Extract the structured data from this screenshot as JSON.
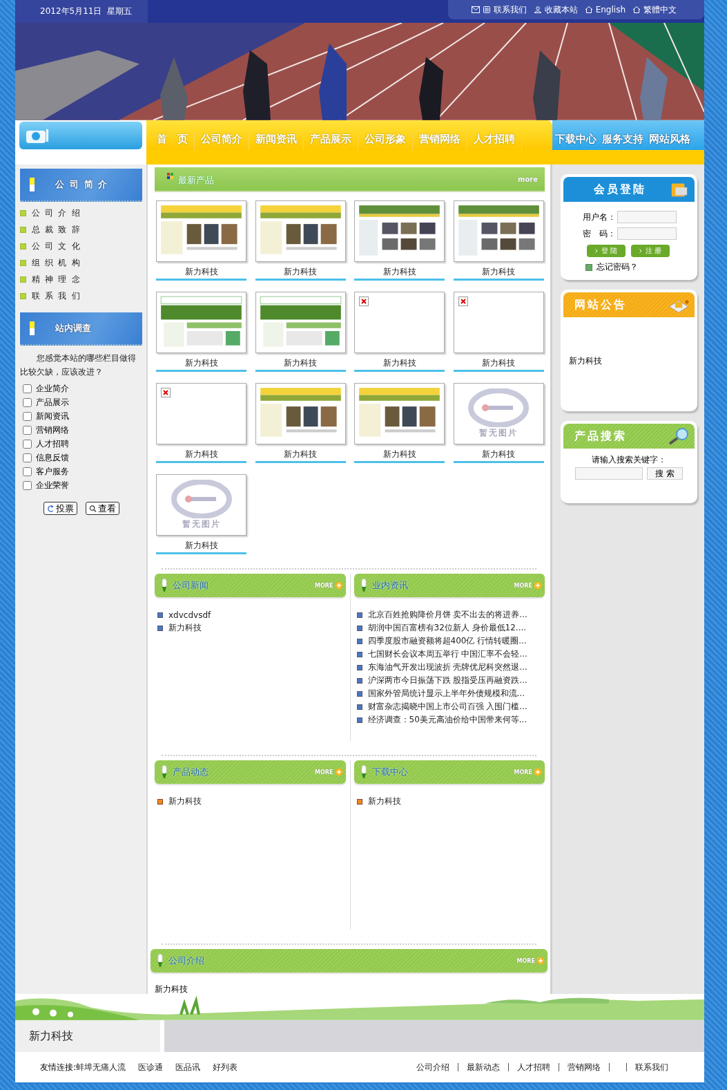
{
  "top_bar": {
    "date": "2012年5月11日  星期五",
    "links": [
      {
        "label": "联系我们",
        "kind": "contact"
      },
      {
        "label": "收藏本站",
        "kind": "bookmark"
      },
      {
        "label": "English",
        "kind": "language"
      },
      {
        "label": "繁體中文",
        "kind": "language"
      }
    ]
  },
  "nav": {
    "items": [
      {
        "label": "首　页",
        "kind": "main"
      },
      {
        "label": "公司简介",
        "kind": "main"
      },
      {
        "label": "新闻资讯",
        "kind": "main"
      },
      {
        "label": "产品展示",
        "kind": "main"
      },
      {
        "label": "公司形象",
        "kind": "main"
      },
      {
        "label": "营销网络",
        "kind": "main"
      },
      {
        "label": "人才招聘",
        "kind": "main"
      },
      {
        "label": "下载中心",
        "kind": "extra"
      },
      {
        "label": "服务支持",
        "kind": "extra"
      },
      {
        "label": "网站风格",
        "kind": "extra"
      }
    ]
  },
  "sidebar": {
    "about": {
      "title": "公司简介",
      "items": [
        "公司介绍",
        "总裁致辞",
        "公司文化",
        "组织机构",
        "精神理念",
        "联系我们"
      ]
    },
    "survey": {
      "title": "站内调查",
      "question": "您感觉本站的哪些栏目做得比较欠缺，应该改进？",
      "options": [
        {
          "label": "企业简介",
          "checked": false
        },
        {
          "label": "产品展示",
          "checked": false
        },
        {
          "label": "新闻资讯",
          "checked": false
        },
        {
          "label": "营销网络",
          "checked": false
        },
        {
          "label": "人才招聘",
          "checked": false
        },
        {
          "label": "信息反馈",
          "checked": false
        },
        {
          "label": "客户服务",
          "checked": false
        },
        {
          "label": "企业荣誉",
          "checked": false
        }
      ],
      "buttons": [
        {
          "label": "投票",
          "kind": "vote"
        },
        {
          "label": "查看",
          "kind": "view"
        }
      ]
    }
  },
  "products": {
    "title": "最新产品",
    "more": "more",
    "items": [
      {
        "caption": "新力科技",
        "kind": "yellow"
      },
      {
        "caption": "新力科技",
        "kind": "yellow"
      },
      {
        "caption": "新力科技",
        "kind": "green"
      },
      {
        "caption": "新力科技",
        "kind": "green"
      },
      {
        "caption": "新力科技",
        "kind": "welcome"
      },
      {
        "caption": "新力科技",
        "kind": "welcome"
      },
      {
        "caption": "新力科技",
        "kind": "broken"
      },
      {
        "caption": "新力科技",
        "kind": "broken"
      },
      {
        "caption": "新力科技",
        "kind": "broken"
      },
      {
        "caption": "新力科技",
        "kind": "yellow"
      },
      {
        "caption": "新力科技",
        "kind": "yellow"
      },
      {
        "caption": "新力科技",
        "kind": "empty",
        "placeholder_text": "暂无图片"
      },
      {
        "caption": "新力科技",
        "kind": "empty",
        "placeholder_text": "暂无图片"
      }
    ]
  },
  "news_rows": [
    [
      {
        "title": "公司新闻",
        "more": "MORE",
        "kind": "news",
        "items": [
          "xdvcdvsdf",
          "新力科技"
        ]
      },
      {
        "title": "业内资讯",
        "more": "MORE",
        "kind": "news",
        "items": [
          "北京百姓抢购降价月饼 卖不出去的将进养...",
          "胡润中国百富榜有32位新人 身价最低12....",
          "四季度股市融资额将超400亿 行情转暖圈...",
          "七国财长会议本周五举行 中国汇率不会轻...",
          "东海油气开发出现波折 壳牌优尼科突然退...",
          "沪深两市今日振荡下跌 股指受压再融资跌...",
          "国家外管局统计显示上半年外债规模和流...",
          "财富杂志揭晓中国上市公司百强 入围门槛...",
          "经济调查：50美元高油价给中国带来何等..."
        ]
      }
    ],
    [
      {
        "title": "产品动态",
        "more": "MORE",
        "kind": "updates",
        "items": [
          "新力科技"
        ]
      },
      {
        "title": "下载中心",
        "more": "MORE",
        "kind": "updates",
        "items": [
          "新力科技"
        ]
      }
    ]
  ],
  "company_intro": {
    "title": "公司介绍",
    "more": "MORE",
    "text": "新力科技"
  },
  "login": {
    "title": "会员登陆",
    "fields": [
      {
        "label": "用户名："
      },
      {
        "label": "密　码："
      }
    ],
    "buttons": [
      "登 陆",
      "注 册"
    ],
    "forgot": "忘记密码？"
  },
  "notice": {
    "title": "网站公告",
    "text": "新力科技"
  },
  "search": {
    "title": "产品搜索",
    "prompt": "请输入搜索关键字：",
    "button": "搜 索"
  },
  "footer": {
    "company": "新力科技",
    "friend_label": "友情连接:",
    "friend_links": [
      "蚌埠无痛人流",
      "医诊通",
      "医品讯",
      "好列表"
    ],
    "site_links": [
      "公司介绍",
      "最新动态",
      "人才招聘",
      "营销网络",
      "联系我们"
    ]
  }
}
